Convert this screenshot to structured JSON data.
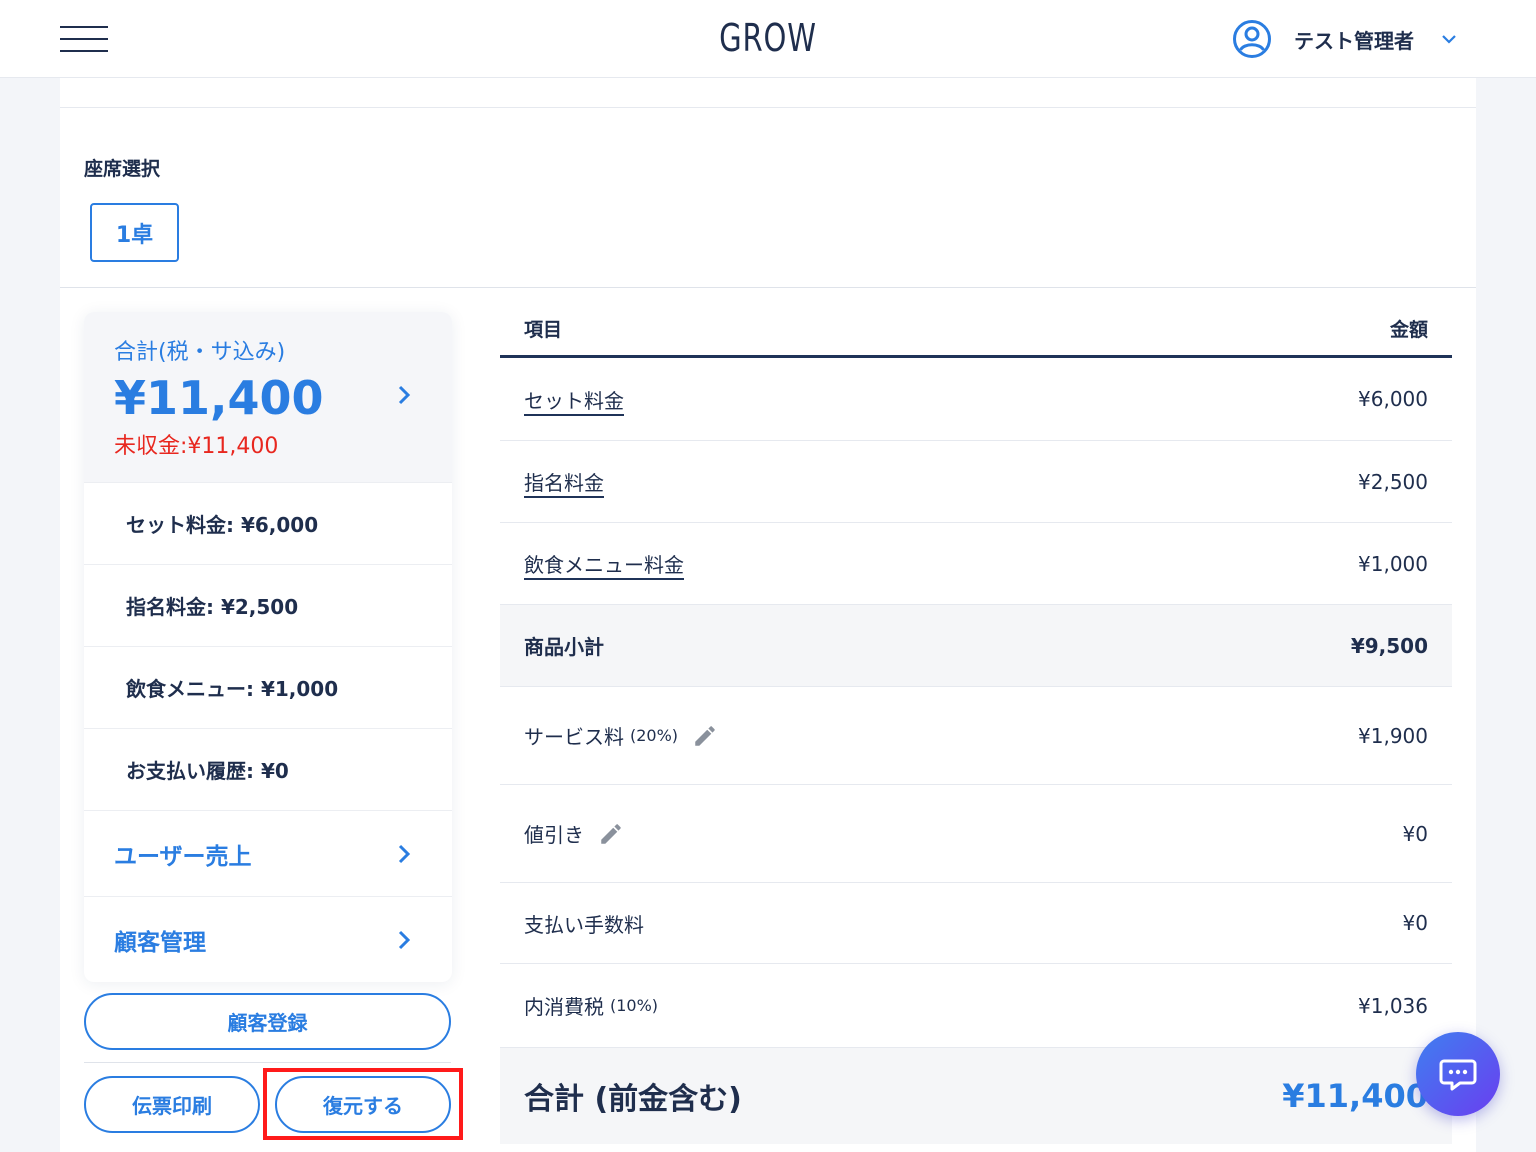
{
  "header": {
    "app_title": "GROW",
    "user_name": "テスト管理者"
  },
  "seat": {
    "title": "座席選択",
    "selected_seat": "1卓"
  },
  "summary": {
    "label": "合計(税・サ込み)",
    "total": "¥11,400",
    "unpaid": "未収金:¥11,400"
  },
  "breakdown": [
    "セット料金: ¥6,000",
    "指名料金: ¥2,500",
    "飲食メニュー: ¥1,000",
    "お支払い履歴: ¥0"
  ],
  "links": {
    "user_sales": "ユーザー売上",
    "customer_mgmt": "顧客管理"
  },
  "buttons": {
    "register": "顧客登録",
    "print": "伝票印刷",
    "restore": "復元する"
  },
  "table": {
    "col_item": "項目",
    "col_amount": "金額",
    "rows": {
      "set_fee": {
        "label": "セット料金",
        "amount": "¥6,000"
      },
      "nomination_fee": {
        "label": "指名料金",
        "amount": "¥2,500"
      },
      "food_fee": {
        "label": "飲食メニュー料金",
        "amount": "¥1,000"
      },
      "subtotal": {
        "label": "商品小計",
        "amount": "¥9,500"
      },
      "service": {
        "label": "サービス料",
        "rate": "(20%)",
        "amount": "¥1,900"
      },
      "discount": {
        "label": "値引き",
        "amount": "¥0"
      },
      "payment_fee": {
        "label": "支払い手数料",
        "amount": "¥0"
      },
      "tax": {
        "label": "内消費税",
        "rate": "(10%)",
        "amount": "¥1,036"
      },
      "total": {
        "label": "合計 (前金含む)",
        "amount": "¥11,400"
      }
    }
  },
  "colors": {
    "accent": "#2a7de1",
    "navy": "#1f2e4d",
    "alert": "#e8271f",
    "highlight": "#ff1a1a"
  },
  "icons": {
    "menu": "hamburger-icon",
    "user": "user-circle-icon",
    "dropdown": "chevron-down-icon",
    "arrow": "chevron-right-icon",
    "edit": "pencil-icon",
    "chat": "chat-bubble-icon"
  }
}
